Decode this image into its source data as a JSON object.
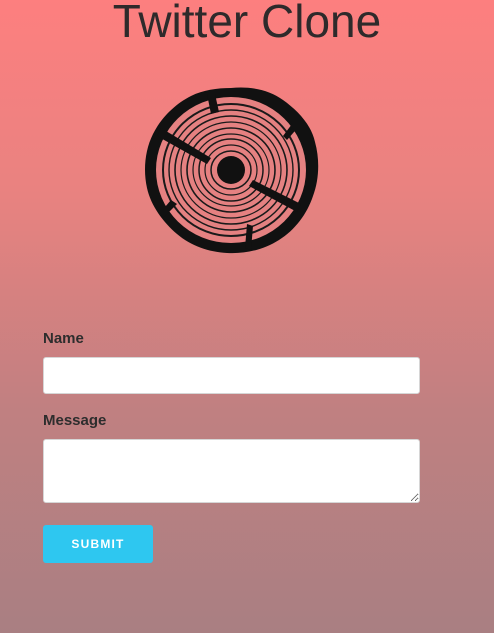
{
  "app": {
    "title": "Twitter Clone",
    "logo_icon": "tree-rings-icon"
  },
  "form": {
    "name_label": "Name",
    "name_value": "",
    "name_placeholder": "",
    "message_label": "Message",
    "message_value": "",
    "message_placeholder": "",
    "submit_label": "SUBMIT"
  },
  "colors": {
    "background_top": "#fd7f7f",
    "background_bottom": "#a97f82",
    "accent_button": "#2ec7f0",
    "text": "#2e2a2b"
  }
}
